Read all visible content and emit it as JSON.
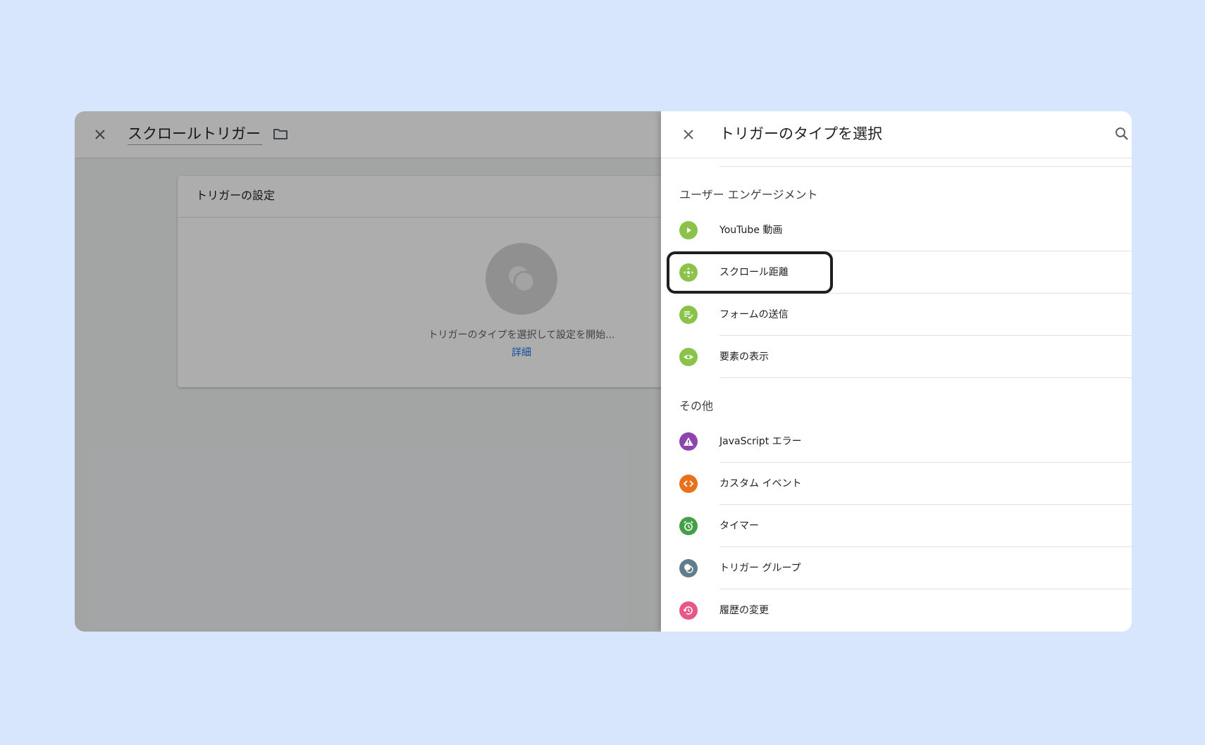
{
  "editor": {
    "title": "スクロールトリガー",
    "card_title": "トリガーの設定",
    "hint": "トリガーのタイプを選択して設定を開始...",
    "link": "詳細"
  },
  "panel": {
    "title": "トリガーのタイプを選択",
    "sections": [
      {
        "label": "ユーザー エンゲージメント",
        "items": [
          {
            "label": "YouTube 動画",
            "icon": "play-icon",
            "color": "#8bc34a"
          },
          {
            "label": "スクロール距離",
            "icon": "move-icon",
            "color": "#8bc34a",
            "highlighted": true
          },
          {
            "label": "フォームの送信",
            "icon": "form-check-icon",
            "color": "#8bc34a"
          },
          {
            "label": "要素の表示",
            "icon": "eye-icon",
            "color": "#8bc34a"
          }
        ]
      },
      {
        "label": "その他",
        "items": [
          {
            "label": "JavaScript エラー",
            "icon": "warning-icon",
            "color": "#8e44ad"
          },
          {
            "label": "カスタム イベント",
            "icon": "code-icon",
            "color": "#e8711c"
          },
          {
            "label": "タイマー",
            "icon": "alarm-icon",
            "color": "#43a047"
          },
          {
            "label": "トリガー グループ",
            "icon": "group-icon",
            "color": "#607d8b"
          },
          {
            "label": "履歴の変更",
            "icon": "history-icon",
            "color": "#e6578a"
          }
        ]
      }
    ]
  }
}
